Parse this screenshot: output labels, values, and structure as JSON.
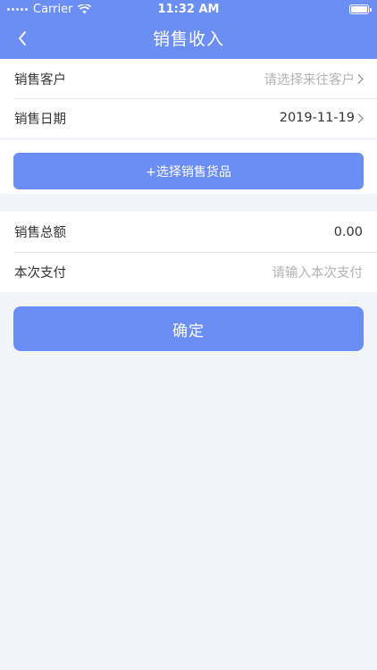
{
  "status_bar": {
    "carrier": "Carrier",
    "time": "11:32 AM"
  },
  "nav": {
    "title": "销售收入",
    "back_icon": "chevron-left-icon"
  },
  "form1": {
    "customer_label": "销售客户",
    "customer_placeholder": "请选择来往客户",
    "date_label": "销售日期",
    "date_value": "2019-11-19"
  },
  "goods": {
    "select_label": "+选择销售货品"
  },
  "form2": {
    "total_label": "销售总额",
    "total_value": "0.00",
    "payment_label": "本次支付",
    "payment_placeholder": "请输入本次支付"
  },
  "confirm_label": "确定",
  "colors": {
    "primary": "#6b8ef5",
    "background": "#f1f5fa"
  }
}
